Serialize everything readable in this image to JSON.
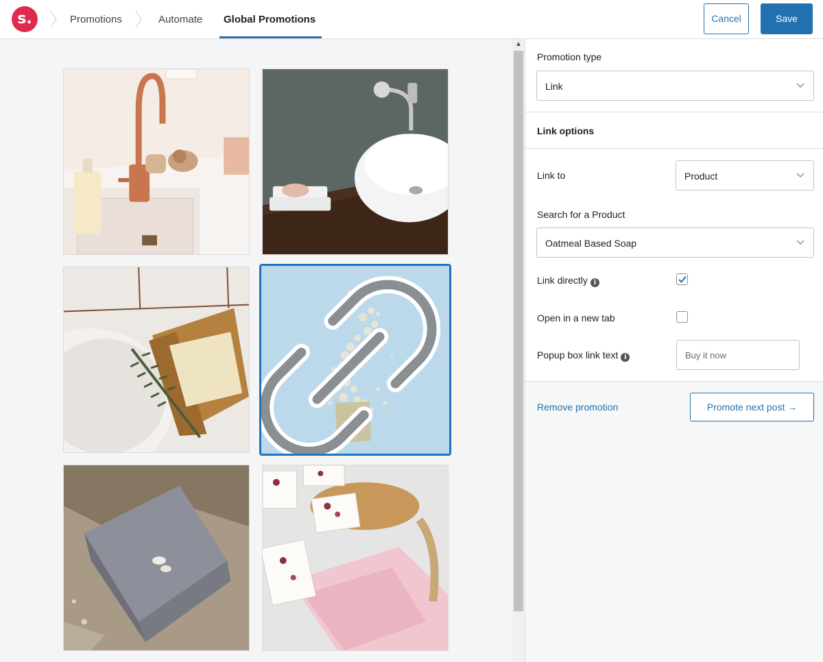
{
  "header": {
    "logo_text": "s.",
    "breadcrumbs": [
      "Promotions",
      "Automate",
      "Global Promotions"
    ],
    "cancel_label": "Cancel",
    "save_label": "Save",
    "accent_color": "#2271b1",
    "brand_color": "#e0294e"
  },
  "grid": {
    "tiles": [
      {
        "name": "copper-faucet-sink",
        "selected": false
      },
      {
        "name": "wall-faucet-basin",
        "selected": false
      },
      {
        "name": "soap-on-wood-dish",
        "selected": false
      },
      {
        "name": "oatmeal-soap-flakes",
        "selected": true,
        "icon": "link-icon"
      },
      {
        "name": "grey-soap-bar",
        "selected": false
      },
      {
        "name": "floral-soap-bars",
        "selected": false
      }
    ]
  },
  "panel": {
    "promotion_type_label": "Promotion type",
    "promotion_type_value": "Link",
    "link_options_title": "Link options",
    "link_to_label": "Link to",
    "link_to_value": "Product",
    "search_product_label": "Search for a Product",
    "search_product_value": "Oatmeal Based Soap",
    "link_directly_label": "Link directly",
    "link_directly_checked": true,
    "open_new_tab_label": "Open in a new tab",
    "open_new_tab_checked": false,
    "popup_link_text_label": "Popup box link text",
    "popup_link_text_placeholder": "Buy it now",
    "remove_promotion_label": "Remove promotion",
    "promote_next_label": "Promote next post →"
  }
}
